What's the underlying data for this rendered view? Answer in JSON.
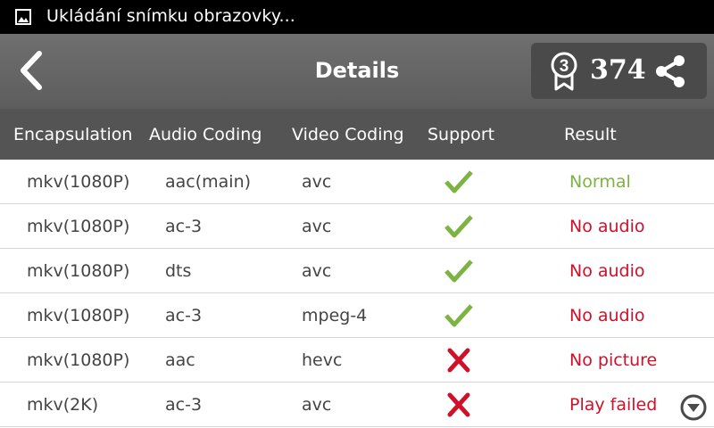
{
  "status_bar": {
    "notification_icon": "image-icon",
    "text": "Ukládání snímku obrazovky..."
  },
  "app_bar": {
    "back_icon": "chevron-left-icon",
    "title": "Details",
    "score_badge_icon": "medal-icon",
    "score_badge_number": "3",
    "score_value": "374",
    "share_icon": "share-icon"
  },
  "table": {
    "columns": [
      "Encapsulation",
      "Audio Coding",
      "Video Coding",
      "Support",
      "Result"
    ],
    "rows": [
      {
        "encapsulation": "mkv(1080P)",
        "audio": "aac(main)",
        "video": "avc",
        "support": "check",
        "result": "Normal"
      },
      {
        "encapsulation": "mkv(1080P)",
        "audio": "ac-3",
        "video": "avc",
        "support": "check",
        "result": "No audio"
      },
      {
        "encapsulation": "mkv(1080P)",
        "audio": "dts",
        "video": "avc",
        "support": "check",
        "result": "No audio"
      },
      {
        "encapsulation": "mkv(1080P)",
        "audio": "ac-3",
        "video": "mpeg-4",
        "support": "check",
        "result": "No audio"
      },
      {
        "encapsulation": "mkv(1080P)",
        "audio": "aac",
        "video": "hevc",
        "support": "cross",
        "result": "No picture"
      },
      {
        "encapsulation": "mkv(2K)",
        "audio": "ac-3",
        "video": "avc",
        "support": "cross",
        "result": "Play failed"
      }
    ]
  },
  "colors": {
    "status_bar_bg": "#000000",
    "app_bar_bg": "#666666",
    "header_bg": "#545454",
    "check_green": "#7cb342",
    "cross_red": "#d0102a",
    "normal_text": "#7cb342",
    "error_text": "#d0102a"
  },
  "scroll_icon": "chevron-down-circle-icon"
}
